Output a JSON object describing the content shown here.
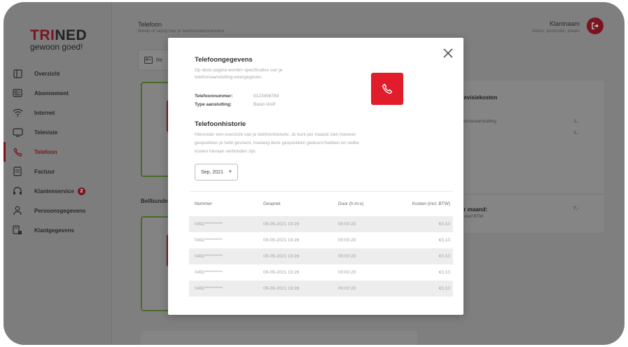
{
  "app": {
    "logo_main_a": "TRI",
    "logo_main_b": "NED",
    "logo_sub": "gewoon goed!"
  },
  "sidebar": {
    "items": [
      {
        "label": "Overzicht",
        "icon": "dashboard-icon"
      },
      {
        "label": "Abonnement",
        "icon": "id-card-icon"
      },
      {
        "label": "Internet",
        "icon": "wifi-icon"
      },
      {
        "label": "Televisie",
        "icon": "tv-icon"
      },
      {
        "label": "Telefoon",
        "icon": "phone-icon",
        "active": true
      },
      {
        "label": "Factuur",
        "icon": "invoice-icon"
      },
      {
        "label": "Klantenservice",
        "icon": "headset-icon",
        "badge": "2"
      },
      {
        "label": "Persoonsgegevens",
        "icon": "person-icon"
      },
      {
        "label": "Klantgegevens",
        "icon": "customer-data-icon"
      }
    ]
  },
  "header": {
    "title": "Telefoon",
    "subtitle": "Bekijk of wijzig hier je telefoonabonnement",
    "user_name": "Klantnaam",
    "user_sub": "Adres, postcode, plaats"
  },
  "background": {
    "tab_label": "Re",
    "bellbundel": "Bellbundel",
    "right_card_title": "televisiekosten",
    "right_card_row": "Televisieaansluiting",
    "right_card_val1": "2,-",
    "right_card_val2": "5,-",
    "right_card_total": "per maand:",
    "right_card_total_sub": "Inclusief BTW",
    "right_card_total_val": "7,-"
  },
  "modal": {
    "title": "Telefoongegevens",
    "description": "Op deze pagina worden specificaties van je telefoonaansluiting weergegeven.",
    "phone_number_label": "Telefoonnummer:",
    "phone_number_value": "0123456789",
    "connection_type_label": "Type aansluiting:",
    "connection_type_value": "Basic-VoIP",
    "history_title": "Telefoonhistorie",
    "history_description": "Hieronder een overzicht van je telefoonhistorie. Je kunt per maand zien hoeveel gesprekken je hebt gevoerd, hoelang deze gesprekken geduurd hebben en welke kosten hieraan verbonden zijn",
    "month_select": "Sep, 2021",
    "table": {
      "headers": [
        "Nummer",
        "Gesprek",
        "Duur (h:m:s)",
        "Kosten (incl. BTW)"
      ],
      "rows": [
        [
          "0492**********",
          "09-09-2021 19:26",
          "00:00:20",
          "€0,10"
        ],
        [
          "0492**********",
          "09-09-2021 19:26",
          "00:00:20",
          "€0,10"
        ],
        [
          "0492**********",
          "09-09-2021 19:26",
          "00:00:20",
          "€0,10"
        ],
        [
          "0492**********",
          "09-09-2021 19:26",
          "00:00:20",
          "€0,10"
        ],
        [
          "0492**********",
          "09-09-2021 19:26",
          "00:00:20",
          "€0,10"
        ]
      ]
    }
  },
  "colors": {
    "accent_red": "#e11d2c",
    "overlay_grey": "#7f7f7f"
  }
}
